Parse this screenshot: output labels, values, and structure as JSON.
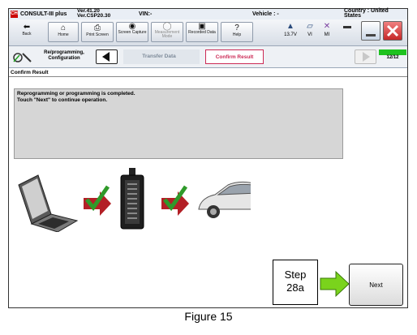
{
  "app": {
    "title": "CONSULT-III plus",
    "version_line1": "Ver.41.20",
    "version_line2": "Ver.CSP20.30",
    "vin_label": "VIN:-",
    "vehicle_label": "Vehicle : -",
    "country_label": "Country : United States"
  },
  "toolbar": {
    "back_label": "Back",
    "home_label": "Home",
    "print_label": "Print Screen",
    "screen_capture_label": "Screen Capture",
    "measurement_mode_label": "Measurement Mode",
    "recorded_data_label": "Recorded Data",
    "help_label": "Help",
    "battery_value": "13.7V",
    "vi_label": "VI",
    "mi_label": "MI"
  },
  "nav": {
    "breadcrumb": "Re/programming, Configuration",
    "steps": [
      {
        "label": "Transfer Data"
      },
      {
        "label": "Confirm Result"
      }
    ],
    "progress_text": "12/12",
    "progress_fraction": 1.0
  },
  "section": {
    "title": "Confirm Result"
  },
  "message": {
    "line1": "Reprogramming or programming is completed.",
    "line2": "Touch \"Next\" to continue operation."
  },
  "actions": {
    "next_label": "Next"
  },
  "annotation": {
    "line1": "Step",
    "line2": "28a"
  },
  "caption": "Figure 15",
  "colors": {
    "accent_step": "#cc2a55",
    "check_green": "#2f9a2a",
    "arrow_red": "#b32026",
    "callout_green": "#7ad31c",
    "progress_green": "#1fc21f"
  },
  "icons": {
    "laptop": "laptop-icon",
    "vi_device": "vi-device-icon",
    "car": "car-icon",
    "check": "check-icon",
    "arrow": "arrow-right-icon"
  }
}
